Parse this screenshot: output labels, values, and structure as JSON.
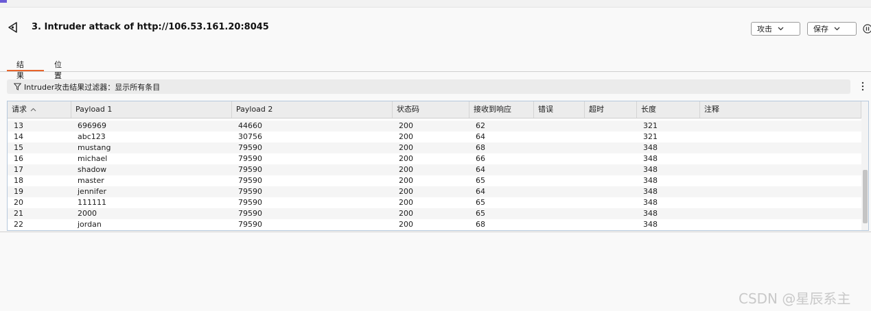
{
  "window": {
    "title": "3. Intruder attack of http://106.53.161.20:8045"
  },
  "toolbar": {
    "attack_label": "攻击",
    "save_label": "保存"
  },
  "tabs": [
    {
      "label": "结果",
      "active": true
    },
    {
      "label": "位置",
      "active": false
    }
  ],
  "filter": {
    "text": "Intruder攻击结果过滤器：显示所有条目"
  },
  "table": {
    "columns": [
      "请求",
      "Payload 1",
      "Payload 2",
      "状态码",
      "接收到响应",
      "错误",
      "超时",
      "长度",
      "注释"
    ],
    "sort_column": "请求",
    "rows": [
      [
        "13",
        "696969",
        "44660",
        "200",
        "62",
        "",
        "",
        "321",
        ""
      ],
      [
        "14",
        "abc123",
        "30756",
        "200",
        "64",
        "",
        "",
        "321",
        ""
      ],
      [
        "15",
        "mustang",
        "79590",
        "200",
        "68",
        "",
        "",
        "348",
        ""
      ],
      [
        "16",
        "michael",
        "79590",
        "200",
        "66",
        "",
        "",
        "348",
        ""
      ],
      [
        "17",
        "shadow",
        "79590",
        "200",
        "64",
        "",
        "",
        "348",
        ""
      ],
      [
        "18",
        "master",
        "79590",
        "200",
        "65",
        "",
        "",
        "348",
        ""
      ],
      [
        "19",
        "jennifer",
        "79590",
        "200",
        "64",
        "",
        "",
        "348",
        ""
      ],
      [
        "20",
        "111111",
        "79590",
        "200",
        "65",
        "",
        "",
        "348",
        ""
      ],
      [
        "21",
        "2000",
        "79590",
        "200",
        "65",
        "",
        "",
        "348",
        ""
      ],
      [
        "22",
        "jordan",
        "79590",
        "200",
        "68",
        "",
        "",
        "348",
        ""
      ]
    ]
  },
  "watermark": "CSDN @星辰系主",
  "colors": {
    "accent": "#e8642a",
    "table_border": "#b5c8dc"
  }
}
